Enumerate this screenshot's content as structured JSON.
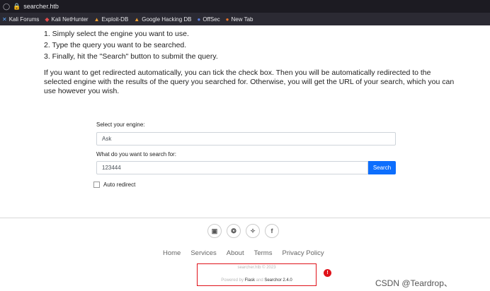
{
  "browser": {
    "url": "searcher.htb",
    "bookmarks": [
      {
        "label": "Kali Forums",
        "icon": "kali-forums-icon",
        "glyph": "✕"
      },
      {
        "label": "Kali NetHunter",
        "icon": "kali-nethunter-icon",
        "glyph": "◆"
      },
      {
        "label": "Exploit-DB",
        "icon": "exploit-db-icon",
        "glyph": "▲"
      },
      {
        "label": "Google Hacking DB",
        "icon": "ghdb-icon",
        "glyph": "▲"
      },
      {
        "label": "OffSec",
        "icon": "offsec-icon",
        "glyph": "●"
      },
      {
        "label": "New Tab",
        "icon": "new-tab-icon",
        "glyph": "●"
      }
    ]
  },
  "instructions": {
    "steps": [
      "1. Simply select the engine you want to use.",
      "2. Type the query you want to be searched.",
      "3. Finally, hit the \"Search\" button to submit the query."
    ],
    "paragraph": "If you want to get redirected automatically, you can tick the check box. Then you will be automatically redirected to the selected engine with the results of the query you searched for. Otherwise, you will get the URL of your search, which you can use however you wish."
  },
  "form": {
    "engine_label": "Select your engine:",
    "engine_value": "Ask",
    "query_label": "What do you want to search for:",
    "query_value": "123444",
    "search_button": "Search",
    "auto_redirect_label": "Auto redirect"
  },
  "footer": {
    "social": [
      {
        "name": "instagram-icon",
        "glyph": "▣"
      },
      {
        "name": "snapchat-icon",
        "glyph": "❂"
      },
      {
        "name": "twitter-icon",
        "glyph": "✧"
      },
      {
        "name": "facebook-icon",
        "glyph": "f"
      }
    ],
    "links": [
      "Home",
      "Services",
      "About",
      "Terms",
      "Privacy Policy"
    ],
    "copyright": "searcher.htb © 2023",
    "powered_prefix": "Powered by",
    "powered_flask": "Flask",
    "powered_and": "and",
    "powered_searchor": "Searchor 2.4.0",
    "marker": "!"
  },
  "watermark": "CSDN @Teardrop、",
  "colors": {
    "accent": "#0d6efd",
    "highlight": "#e0121a"
  }
}
